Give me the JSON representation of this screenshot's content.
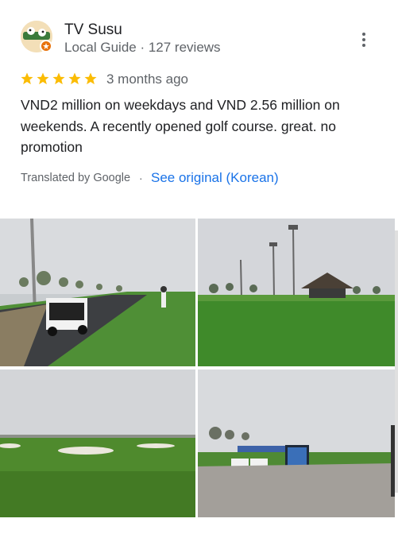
{
  "review": {
    "reviewer_name": "TV Susu",
    "reviewer_meta": "Local Guide · 127 reviews",
    "rating": 5,
    "rating_max": 5,
    "star_color": "#fbbc04",
    "date": "3 months ago",
    "text": "VND2 million on weekdays and VND 2.56 million on weekends. A recently opened golf course. great. no promotion",
    "translated_label": "Translated by Google",
    "separator": "·",
    "see_original_label": "See original (Korean)",
    "link_color": "#1a73e8"
  },
  "photos": [
    {
      "subject": "golf cart on cart path beside fairway"
    },
    {
      "subject": "thatched pavilion on green lawn"
    },
    {
      "subject": "fairway with sand bunkers"
    },
    {
      "subject": "plaza with billboard and golf carts"
    }
  ]
}
